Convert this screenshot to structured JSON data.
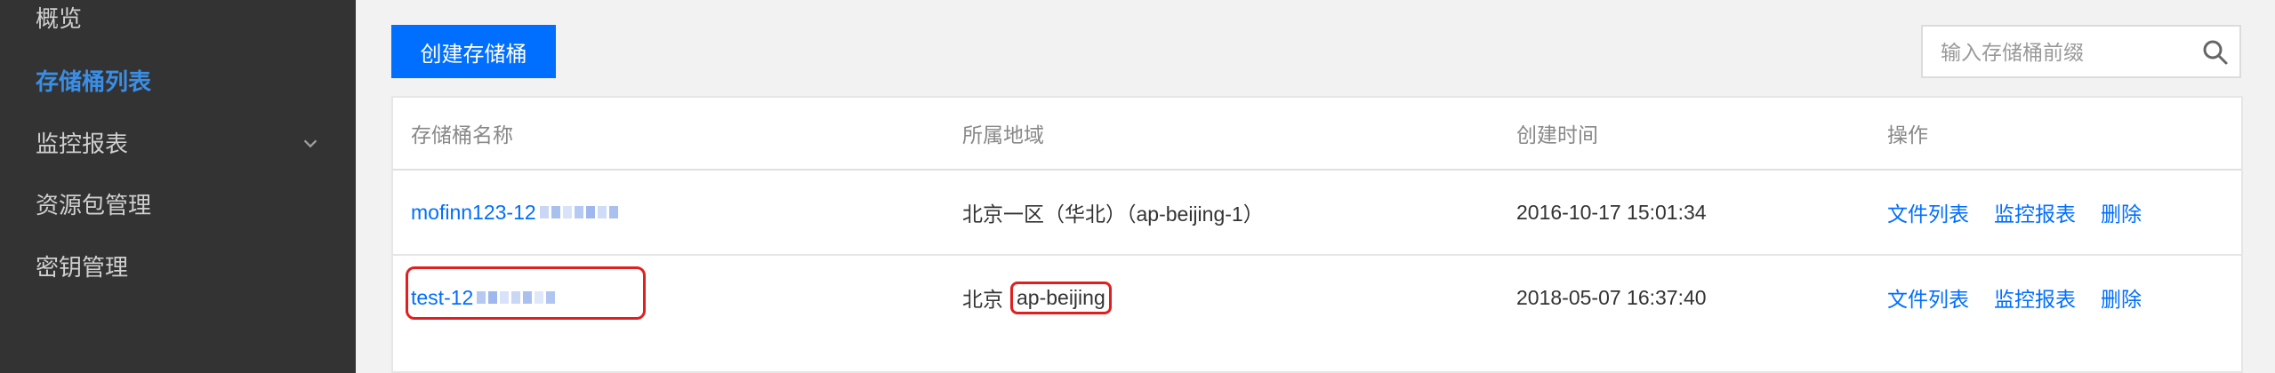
{
  "sidebar": {
    "items": [
      {
        "label": "概览"
      },
      {
        "label": "存储桶列表",
        "active": true
      },
      {
        "label": "监控报表",
        "icon": "chevron-down-icon"
      },
      {
        "label": "资源包管理"
      },
      {
        "label": "密钥管理"
      }
    ]
  },
  "toolbar": {
    "create_label": "创建存储桶",
    "search_placeholder": "输入存储桶前缀"
  },
  "table": {
    "headers": [
      "存储桶名称",
      "所属地域",
      "创建时间",
      "操作"
    ],
    "rows": [
      {
        "name": "mofinn123-12",
        "region": "北京一区（华北）（ap-beijing-1）",
        "created": "2016-10-17 15:01:34",
        "actions": [
          "文件列表",
          "监控报表",
          "删除"
        ]
      },
      {
        "name": "test-12",
        "region_prefix": "北京",
        "region_code": "ap-beijing",
        "created": "2018-05-07 16:37:40",
        "actions": [
          "文件列表",
          "监控报表",
          "删除"
        ]
      }
    ]
  },
  "colors": {
    "sidebar_bg": "#333333",
    "accent": "#006eff",
    "highlight": "#e02020"
  }
}
